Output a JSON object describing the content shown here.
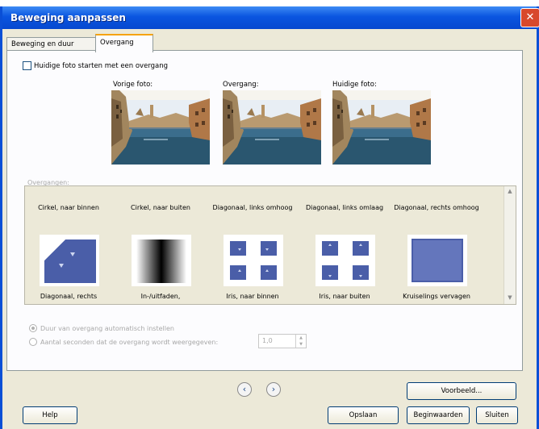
{
  "window": {
    "title": "Beweging aanpassen",
    "close_glyph": "✕"
  },
  "tabs": [
    {
      "label": "Beweging en duur",
      "active": false
    },
    {
      "label": "Overgang",
      "active": true
    }
  ],
  "start_checkbox": {
    "label": "Huidige foto starten met een overgang",
    "checked": false
  },
  "preview": {
    "previous_label": "Vorige foto:",
    "transition_label": "Overgang:",
    "current_label": "Huidige foto:"
  },
  "transitions": {
    "section_label": "Overgangen:",
    "row1": [
      "Cirkel, naar binnen",
      "Cirkel, naar buiten",
      "Diagonaal, links omhoog",
      "Diagonaal, links omlaag",
      "Diagonaal, rechts omhoog"
    ],
    "row2": [
      "Diagonaal, rechts",
      "In-/uitfaden,",
      "Iris, naar binnen",
      "Iris, naar buiten",
      "Kruiselings vervagen"
    ]
  },
  "duration": {
    "auto_label": "Duur van overgang automatisch instellen",
    "auto_selected": true,
    "manual_label": "Aantal seconden dat de overgang wordt weergegeven:",
    "seconds_value": "1,0"
  },
  "buttons": {
    "preview": "Voorbeeld...",
    "help": "Help",
    "save": "Opslaan",
    "defaults": "Beginwaarden",
    "close": "Sluiten"
  },
  "nav": {
    "prev_glyph": "‹",
    "next_glyph": "›"
  },
  "colors": {
    "title_bar": "#0a55e0",
    "tab_accent": "#f5a30b",
    "thumb_blue": "#4a5ea8"
  }
}
